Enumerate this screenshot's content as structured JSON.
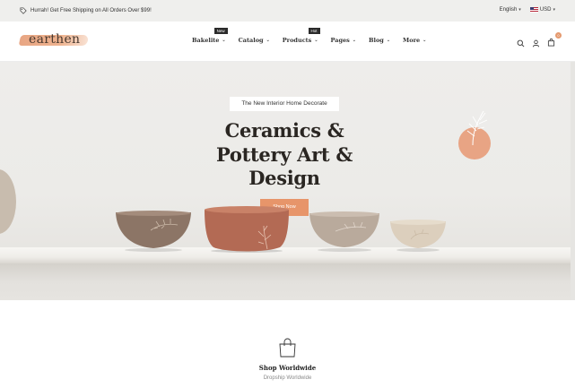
{
  "announcement": {
    "message": "Hurrah! Get Free Shipping on All Orders Over $99!",
    "language": "English",
    "currency": "USD"
  },
  "header": {
    "logo_text": "earthen",
    "nav": [
      {
        "label": "Bakelite",
        "badge": "New"
      },
      {
        "label": "Catalog",
        "badge": ""
      },
      {
        "label": "Products",
        "badge": "Hot"
      },
      {
        "label": "Pages",
        "badge": ""
      },
      {
        "label": "Blog",
        "badge": ""
      },
      {
        "label": "More",
        "badge": ""
      }
    ],
    "cart_count": "0"
  },
  "hero": {
    "eyebrow": "The New Interior Home Decorate",
    "headline_line1": "Ceramics &",
    "headline_line2": "Pottery Art &",
    "headline_line3": "Design",
    "cta": "Shop Now"
  },
  "service": {
    "title": "Shop Worldwide",
    "subtitle": "Dropship Worldwide"
  },
  "colors": {
    "accent": "#e7956a",
    "hero_bg": "#eeedeb",
    "dark_text": "#2a2622"
  }
}
